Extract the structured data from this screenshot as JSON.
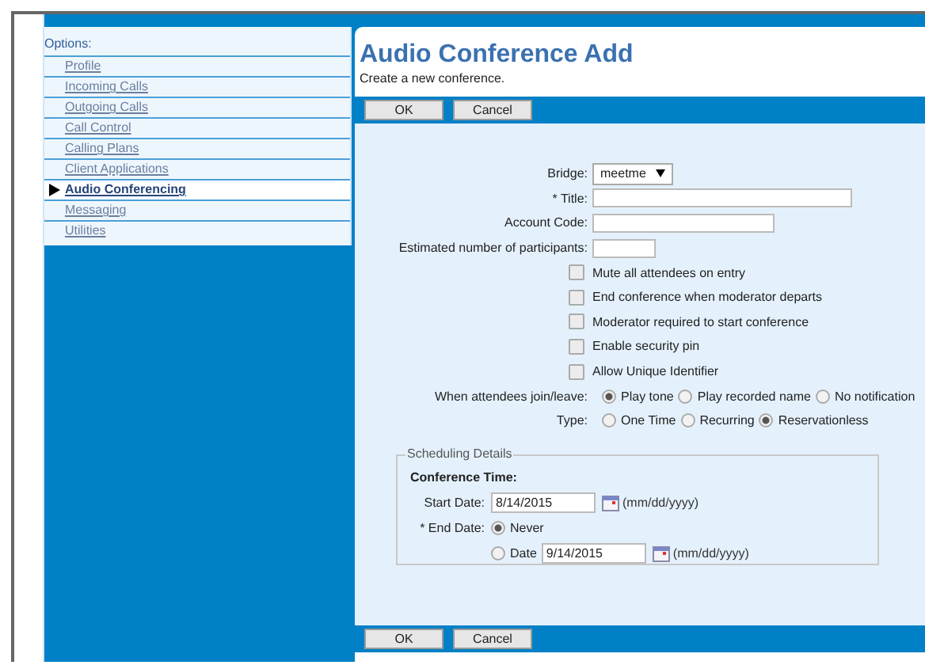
{
  "sidebar": {
    "heading": "Options:",
    "items": [
      {
        "label": "Profile",
        "selected": false
      },
      {
        "label": "Incoming Calls",
        "selected": false
      },
      {
        "label": "Outgoing Calls",
        "selected": false
      },
      {
        "label": "Call Control",
        "selected": false
      },
      {
        "label": "Calling Plans",
        "selected": false
      },
      {
        "label": "Client Applications",
        "selected": false
      },
      {
        "label": "Audio Conferencing",
        "selected": true
      },
      {
        "label": "Messaging",
        "selected": false
      },
      {
        "label": "Utilities",
        "selected": false
      }
    ]
  },
  "page": {
    "title": "Audio Conference Add",
    "subtitle": "Create a new conference."
  },
  "top_buttons": [
    "OK",
    "Cancel"
  ],
  "form": [
    {
      "kind": "select",
      "label": "Bridge:",
      "value": "meetme"
    },
    {
      "kind": "text",
      "label": "* Title:"
    },
    {
      "kind": "text",
      "label": "Account Code:"
    },
    {
      "kind": "text",
      "label": "Estimated number of participants:"
    },
    {
      "kind": "checkbox",
      "label": "Mute all attendees on entry",
      "checked": false
    },
    {
      "kind": "checkbox",
      "label": "End conference when moderator departs",
      "checked": false
    },
    {
      "kind": "checkbox",
      "label": "Moderator required to start conference",
      "checked": false
    },
    {
      "kind": "checkbox",
      "label": "Enable security pin",
      "checked": false
    },
    {
      "kind": "checkbox",
      "label": "Allow Unique Identifier",
      "checked": false
    },
    {
      "kind": "radio",
      "label": "When attendees join/leave:",
      "options": [
        {
          "label": "Play tone",
          "selected": true
        },
        {
          "label": "Play recorded name",
          "selected": false
        },
        {
          "label": "No notification",
          "selected": false
        }
      ]
    },
    {
      "kind": "radio",
      "label": "Type:",
      "options": [
        {
          "label": "One Time",
          "selected": false
        },
        {
          "label": "Recurring",
          "selected": false
        },
        {
          "label": "Reservationless",
          "selected": true
        }
      ]
    }
  ],
  "scheduling": {
    "legend": "Scheduling Details",
    "heading": "Conference Time:",
    "start": {
      "label": "Start Date:",
      "value": "8/14/2015",
      "hint": "(mm/dd/yyyy)"
    },
    "end": {
      "label": "* End Date:",
      "options": [
        {
          "label": "Never",
          "selected": true
        },
        {
          "label": "Date",
          "selected": false,
          "value": "9/14/2015",
          "hint": "(mm/dd/yyyy)"
        }
      ]
    }
  },
  "bottom_buttons": [
    "OK",
    "Cancel"
  ]
}
